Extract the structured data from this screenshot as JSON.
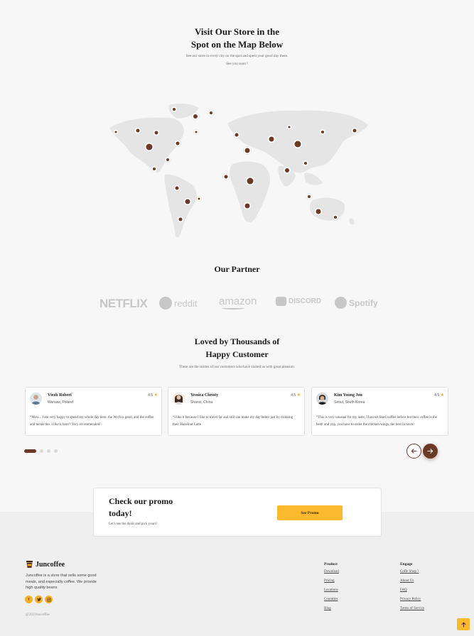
{
  "store": {
    "title_line1": "Visit Our Store in the",
    "title_line2": "Spot on the Map Below",
    "subtitle_line1": "See our store in every city on the spot and spent your good day there.",
    "subtitle_line2": "See you soon !"
  },
  "partner": {
    "title": "Our Partner",
    "logos": [
      "NETFLIX",
      "reddit",
      "amazon",
      "DISCORD",
      "Spotify"
    ]
  },
  "testimonials": {
    "title_line1": "Loved by Thousands of",
    "title_line2": "Happy Customer",
    "subtitle": "These are the stories of our customers who have visited us with great pleasure.",
    "cards": [
      {
        "name": "Viezh Robert",
        "location": "Warsaw, Poland",
        "rating": "4.5",
        "text": "“Wow... I am very happy to spend my whole day here. the Wi-fi is good, and the coffee and meals tho. I like it here!! Very recommended!"
      },
      {
        "name": "Yessica Christy",
        "location": "Shanxi, China",
        "rating": "4.5",
        "text": "“I like it because I like to travel far and still can make my day better just by drinking their Hazelnut Latte"
      },
      {
        "name": "Kim Young Jou",
        "location": "Seoul, South Korea",
        "rating": "4.5",
        "text": "“This is very unusual for my taste, I haven't liked coffee before but their coffee is the best! and yup, you have to order the chicken wings, the best in town!"
      }
    ],
    "active_slide": 1,
    "slide_count": 4
  },
  "promo": {
    "title_line1": "Check our promo",
    "title_line2": "today!",
    "subtitle": "Let's see the deals and pick yours!",
    "button": "See Promo"
  },
  "footer": {
    "brand": "Juncoffee",
    "description": "Juncoffee is a store that sells some good meals, and especially coffee. We provide high quality beans",
    "socials": [
      "facebook-icon",
      "twitter-icon",
      "instagram-icon"
    ],
    "copyright": "@2023Juncoffee",
    "product": {
      "heading": "Product",
      "links": [
        "Download",
        "Pricing",
        "Locations",
        "Countries",
        "Blog"
      ]
    },
    "engage": {
      "heading": "Engage",
      "links": [
        "Coffe Shop ?",
        "About Us",
        "FAQ",
        "Privacy Policy",
        "Terms of Service"
      ]
    }
  },
  "colors": {
    "accent": "#6b3a27",
    "promo_button": "#fbb92e",
    "background": "#f7f7f7"
  }
}
